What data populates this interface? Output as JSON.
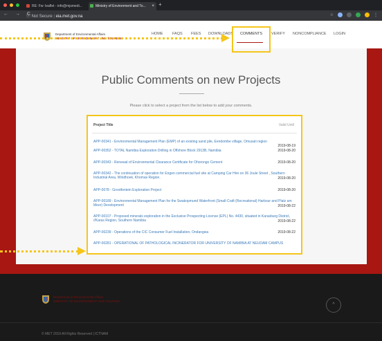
{
  "browser": {
    "tabs": [
      {
        "title": "RE: Fw: leaflet - info@mjsmedi...",
        "favicon_color": "#d44638"
      },
      {
        "title": "Ministry of Environment and To...",
        "favicon_color": "#4caf50",
        "active": true
      }
    ],
    "close_glyph": "×",
    "new_tab_glyph": "+",
    "nav_glyphs": "← → C",
    "security_label": "ⓘ Not Secure",
    "url": "eia.met.gov.na",
    "toolbar_glyphs": "☆",
    "menu_glyph": "⋮"
  },
  "header": {
    "org_line1": "Department of Environmental Affairs",
    "org_line2": "MINISTRY OF ENVIRONMENT AND TOURISM",
    "nav": [
      "HOME",
      "FAQS",
      "FEES",
      "DOWNLOADS",
      "COMMENTS",
      "VERIFY",
      "NONCOMPLIANCE",
      "LOGIN"
    ],
    "active_nav": "COMMENTS"
  },
  "main": {
    "title": "Public Comments on new Projects",
    "subtitle": "Please click to select a project from the list below to add your comments.",
    "columns": [
      "Project Title",
      "Valid Until"
    ],
    "rows": [
      {
        "title": "APP-00341 - Environmental Management Plan (EMP) of an existing sand pile, Eendombe village, Omusati region",
        "date": "2019-08-19"
      },
      {
        "title": "APP-00352 - TOTAL Namibia Exploration Drilling in Offshore Block 2913B, Namibia",
        "date": "2019-08-20"
      },
      {
        "title": "APP-00343 - Renewal of Environmental Clearance Certificate for Ohorongo Cement",
        "date": "2019-08-20"
      },
      {
        "title": "APP-00342 - The continuation of operation for Engen commercial fuel site at Camping Car Hire on 36 Joule Street , Southern Industrial Area, Windhoek, Khomas Region.",
        "date": "2019-08-20"
      },
      {
        "title": "APP-0078 - Grootfontein Exploration Project",
        "date": "2019-08-20"
      },
      {
        "title": "APP-00189 - Environmental Management Plan for the Swakopmund Waterfront (Small-Craft (Recreational) Harbour and Platz am Meer) Development",
        "date": "2019-08-22"
      },
      {
        "title": "APP-00107 - Proposed minerals exploration in the Exclusive Prospecting License (EPL) No. 4430, situated in Karasburg District, //Karas Region, Southern Namibia",
        "date": "2019-08-22"
      },
      {
        "title": "APP-00239 - Operations of the CIC Consumer Fuel Installation, Ondangwa",
        "date": "2019-08-22"
      },
      {
        "title": "APP-00281 - OPERATIONAL OF PATHOLOGICAL INCINERATOR FOR UNIVERSITY OF NAMIBIA AT NEUDAM CAMPUS",
        "date": ""
      }
    ]
  },
  "footer": {
    "org_line1": "Department of Environmental Affairs",
    "org_line2": "MINISTRY OF ENVIRONMENT AND TOURISM",
    "scroll_glyph": "^",
    "copyright": "© MET 2019 All Rights Reserved | ICTNAM"
  },
  "colors": {
    "brand_red": "#a81712",
    "highlight": "#f5c518",
    "link_blue": "#3a7ab8"
  }
}
